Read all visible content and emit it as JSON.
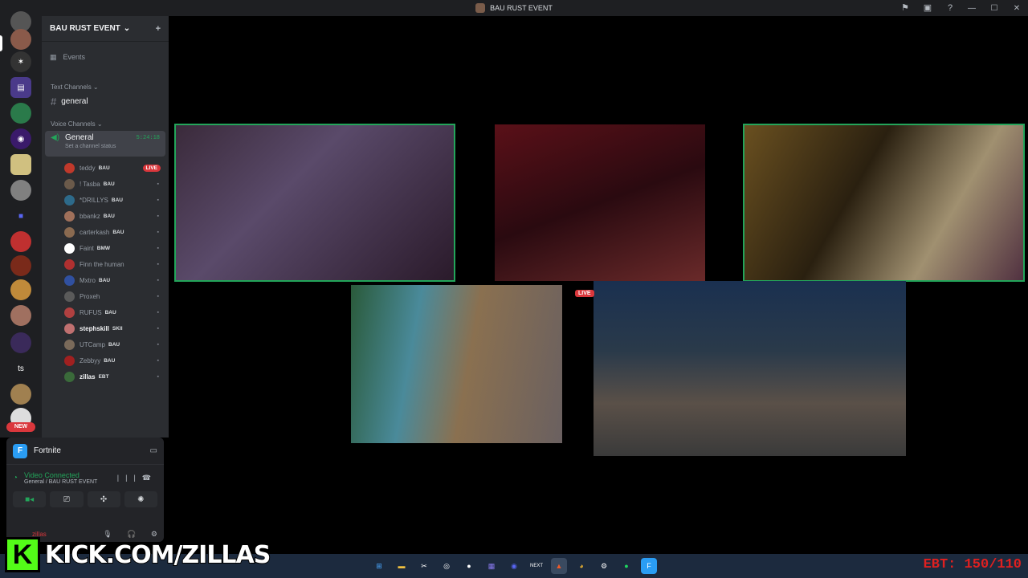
{
  "window": {
    "title": "BAU RUST EVENT"
  },
  "server": {
    "name": "BAU RUST EVENT",
    "events_label": "Events"
  },
  "categories": {
    "text": "Text Channels",
    "voice": "Voice Channels"
  },
  "text_channels": [
    {
      "name": "general"
    }
  ],
  "voice_channel": {
    "name": "General",
    "timer": "5:24:18",
    "status": "Set a channel status"
  },
  "members": [
    {
      "name": "teddy",
      "tag": "BAU",
      "live": "LIVE",
      "color": "#c0392b"
    },
    {
      "name": "! Tasba",
      "tag": "BAU",
      "color": "#6b5a4a"
    },
    {
      "name": "*DRILLYS",
      "tag": "BAU",
      "color": "#2d6a8a"
    },
    {
      "name": "bbankz",
      "tag": "BAU",
      "color": "#a0705a"
    },
    {
      "name": "carterkash",
      "tag": "BAU",
      "color": "#8a6a50"
    },
    {
      "name": "Faint",
      "tag": "BMW",
      "color": "#ffffff"
    },
    {
      "name": "Finn the human",
      "tag": "",
      "color": "#b03030"
    },
    {
      "name": "Mxtro",
      "tag": "BAU",
      "color": "#3050a0"
    },
    {
      "name": "Proxeh",
      "tag": "",
      "color": "#5a5a5a"
    },
    {
      "name": "RUFUS",
      "tag": "BAU",
      "color": "#b04040"
    },
    {
      "name": "stephskill",
      "tag": "SKII",
      "color": "#c07070"
    },
    {
      "name": "UTCamp",
      "tag": "BAU",
      "color": "#7a6a5a"
    },
    {
      "name": "Zebbyy",
      "tag": "BAU",
      "color": "#a02020"
    },
    {
      "name": "zillas",
      "tag": "EBT",
      "color": "#3a6a3a"
    }
  ],
  "servers": {
    "ts_label": "ts",
    "new_badge": "NEW"
  },
  "activity": {
    "name": "Fortnite"
  },
  "voice_status": {
    "state": "Video Connected",
    "location": "General / BAU RUST EVENT"
  },
  "user": {
    "name": "zillas"
  },
  "stage": {
    "live_label": "LIVE"
  },
  "overlay": {
    "kick_text": "KICK.COM/ZILLAS",
    "kick_logo": "K",
    "ebt_text": "EBT: 150/110"
  },
  "taskbar": {
    "items": [
      "windows-icon",
      "file-explorer-icon",
      "capcut-icon",
      "obs-icon",
      "github-icon",
      "app-grid-icon",
      "discord-icon",
      "next-icon",
      "brave-icon",
      "chrome-icon",
      "steam-icon",
      "spotify-icon",
      "fortnite-icon"
    ]
  }
}
